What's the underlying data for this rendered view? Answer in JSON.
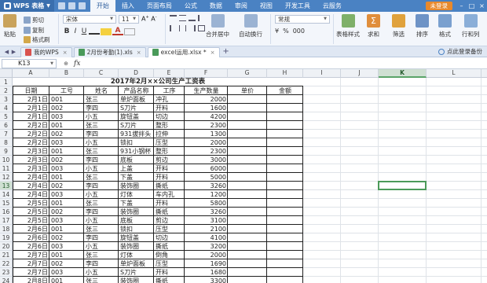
{
  "app": {
    "name": "WPS 表格"
  },
  "ribbon_tabs": [
    "开始",
    "插入",
    "页面布局",
    "公式",
    "数据",
    "审阅",
    "视图",
    "开发工具",
    "云服务"
  ],
  "login_label": "未登录",
  "toolbar": {
    "cut": "剪切",
    "paste": "粘贴",
    "copy": "复制",
    "format_painter": "格式刷",
    "font_name": "宋体",
    "font_size": "11",
    "bold": "B",
    "italic": "I",
    "underline": "U",
    "merge_center": "合并居中",
    "wrap_text": "自动换行",
    "number_format": "常规",
    "currency": "¥",
    "percent": "%",
    "thousands": "000",
    "table_style": "表格样式",
    "sum": "求和",
    "filter": "筛选",
    "sort": "排序",
    "format": "格式",
    "rows_cols": "行和列"
  },
  "document_tabs": [
    {
      "label": "我的WPS",
      "active": false
    },
    {
      "label": "2月份考勤(1).xls",
      "active": false
    },
    {
      "label": "excel运用.xlsx *",
      "active": true
    }
  ],
  "backup_label": "点此登录备份",
  "formula_bar": {
    "cell_ref": "K13",
    "fx": "fx",
    "content": ""
  },
  "grid": {
    "columns": [
      "A",
      "B",
      "C",
      "D",
      "E",
      "F",
      "G",
      "H",
      "I",
      "J",
      "K",
      "L",
      "M"
    ],
    "selected_column": "K",
    "selected_row": 13,
    "rows": [
      1,
      2,
      3,
      4,
      5,
      6,
      7,
      8,
      9,
      10,
      11,
      12,
      13,
      14,
      15,
      16,
      17,
      18,
      19,
      20,
      21,
      22,
      23,
      24,
      25
    ]
  },
  "sheet": {
    "title": "2017年2月××公司生产工资表",
    "headers": [
      "日期",
      "工号",
      "姓名",
      "产品名称",
      "工序",
      "生产数量",
      "单价",
      "金额"
    ],
    "records": [
      [
        "2月1日",
        "001",
        "张三",
        "单炉面板",
        "冲孔",
        "2000"
      ],
      [
        "2月1日",
        "002",
        "李四",
        "S刀片",
        "开料",
        "1600"
      ],
      [
        "2月1日",
        "003",
        "小五",
        "旋钮盖",
        "切边",
        "4200"
      ],
      [
        "2月2日",
        "001",
        "张三",
        "S刀片",
        "整形",
        "2300"
      ],
      [
        "2月2日",
        "002",
        "李四",
        "931拔拌头",
        "拉伸",
        "1300"
      ],
      [
        "2月2日",
        "003",
        "小五",
        "锁扣",
        "压型",
        "2000"
      ],
      [
        "2月3日",
        "001",
        "张三",
        "931小钢杯",
        "整形",
        "2300"
      ],
      [
        "2月3日",
        "002",
        "李四",
        "底板",
        "剪边",
        "3000"
      ],
      [
        "2月3日",
        "003",
        "小五",
        "上盖",
        "开料",
        "6000"
      ],
      [
        "2月4日",
        "001",
        "张三",
        "下盖",
        "开料",
        "5000"
      ],
      [
        "2月4日",
        "002",
        "李四",
        "装饰圈",
        "撕纸",
        "3260"
      ],
      [
        "2月4日",
        "003",
        "小五",
        "灯体",
        "车内孔",
        "1200"
      ],
      [
        "2月5日",
        "001",
        "张三",
        "下盖",
        "开料",
        "5800"
      ],
      [
        "2月5日",
        "002",
        "李四",
        "装饰圈",
        "撕纸",
        "3260"
      ],
      [
        "2月5日",
        "003",
        "小五",
        "底板",
        "剪边",
        "3100"
      ],
      [
        "2月6日",
        "001",
        "张三",
        "锁扣",
        "压型",
        "2100"
      ],
      [
        "2月6日",
        "002",
        "李四",
        "旋钮盖",
        "切边",
        "4100"
      ],
      [
        "2月6日",
        "003",
        "小五",
        "装饰圈",
        "撕纸",
        "3200"
      ],
      [
        "2月7日",
        "001",
        "张三",
        "灯体",
        "倒角",
        "2000"
      ],
      [
        "2月7日",
        "002",
        "李四",
        "单炉面板",
        "压型",
        "1690"
      ],
      [
        "2月7日",
        "003",
        "小五",
        "S刀片",
        "开料",
        "1680"
      ],
      [
        "2月8日",
        "001",
        "张三",
        "装饰圈",
        "撕纸",
        "3300"
      ],
      [
        "2月8日",
        "002",
        "李四",
        "灯体",
        "车内孔",
        "1500"
      ],
      [
        "2月8日",
        "003",
        "小五",
        "锁扣",
        "压型",
        "2200"
      ]
    ]
  },
  "colors": {
    "title_bar": "#4a82c3",
    "login_button": "#e8892c",
    "selection": "#4c9b5a"
  }
}
